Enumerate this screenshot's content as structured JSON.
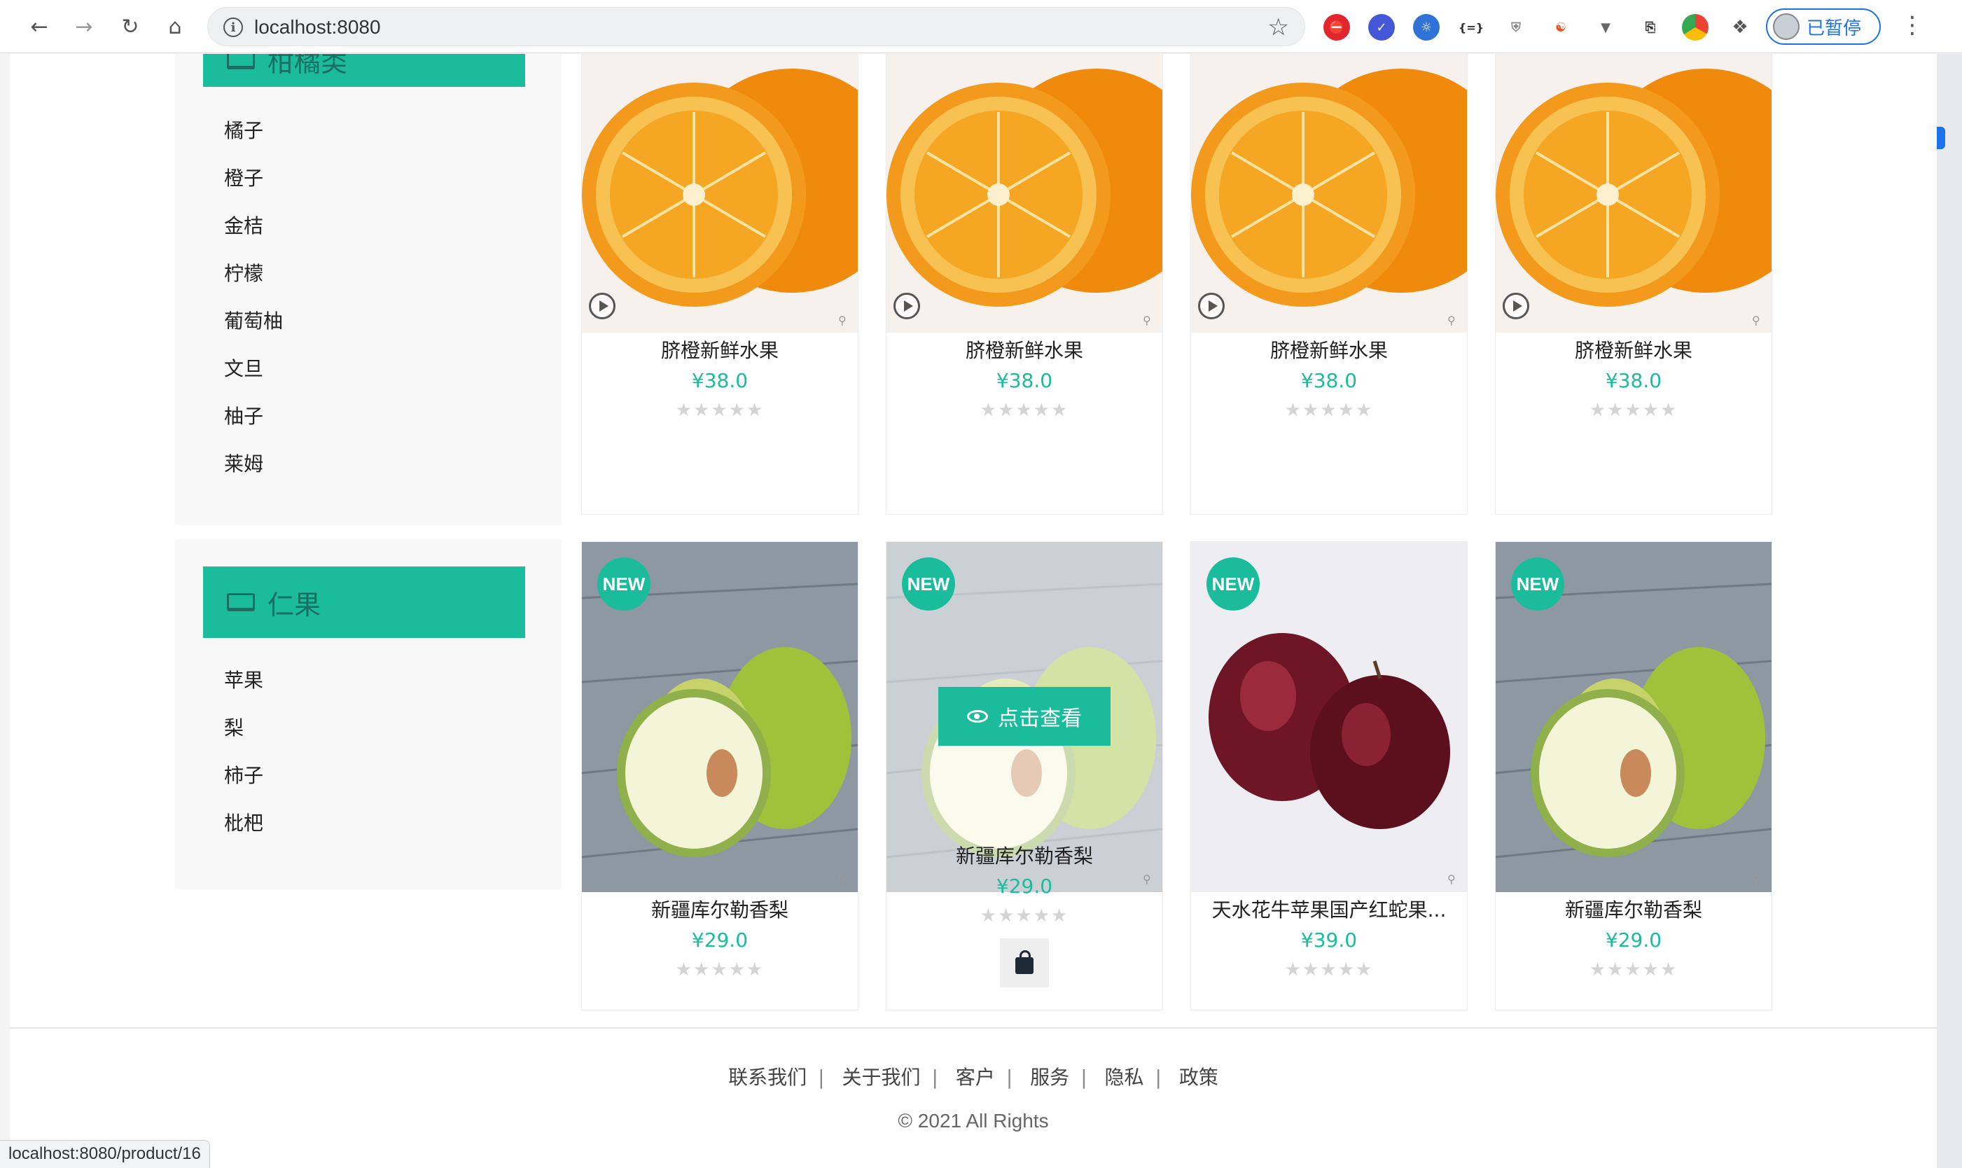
{
  "browser": {
    "url": "localhost:8080",
    "profile_status": "已暂停",
    "status_url": "localhost:8080/product/16"
  },
  "categories": [
    {
      "title": "柑橘类",
      "items": [
        "橘子",
        "橙子",
        "金桔",
        "柠檬",
        "葡萄柚",
        "文旦",
        "柚子",
        "莱姆"
      ]
    },
    {
      "title": "仁果",
      "items": [
        "苹果",
        "梨",
        "柿子",
        "枇杷"
      ]
    }
  ],
  "products_row1": [
    {
      "name": "脐橙新鲜水果",
      "price": "¥38.0",
      "stars": "★★★★★"
    },
    {
      "name": "脐橙新鲜水果",
      "price": "¥38.0",
      "stars": "★★★★★"
    },
    {
      "name": "脐橙新鲜水果",
      "price": "¥38.0",
      "stars": "★★★★★"
    },
    {
      "name": "脐橙新鲜水果",
      "price": "¥38.0",
      "stars": "★★★★★"
    }
  ],
  "products_row2": [
    {
      "badge": "NEW",
      "name": "新疆库尔勒香梨",
      "price": "¥29.0",
      "stars": "★★★★★"
    },
    {
      "badge": "NEW",
      "name": "新疆库尔勒香梨",
      "price": "¥29.0",
      "stars": "★★★★★",
      "view_label": "点击查看"
    },
    {
      "badge": "NEW",
      "name": "天水花牛苹果国产红蛇果...",
      "price": "¥39.0",
      "stars": "★★★★★"
    },
    {
      "badge": "NEW",
      "name": "新疆库尔勒香梨",
      "price": "¥29.0",
      "stars": "★★★★★"
    }
  ],
  "footer": {
    "links": [
      "联系我们",
      "关于我们",
      "客户",
      "服务",
      "隐私",
      "政策"
    ],
    "separator": "|",
    "copyright": "© 2021 All Rights"
  },
  "colors": {
    "accent": "#1abc9c",
    "star": "#d4d4d4"
  }
}
